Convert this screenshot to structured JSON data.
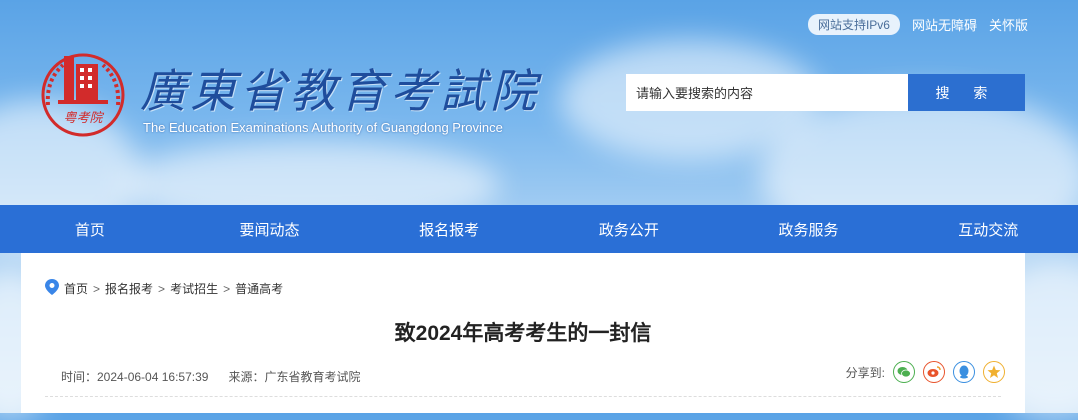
{
  "header": {
    "title_cn": "廣東省教育考試院",
    "title_en": "The Education Examinations Authority of Guangdong Province",
    "emblem_text": "粤考院",
    "ipv6_label": "网站支持IPv6",
    "accessibility_label": "网站无障碍",
    "care_label": "关怀版"
  },
  "search": {
    "placeholder": "请输入要搜索的内容",
    "button_label": "搜 索"
  },
  "nav": {
    "items": [
      {
        "label": "首页"
      },
      {
        "label": "要闻动态"
      },
      {
        "label": "报名报考"
      },
      {
        "label": "政务公开"
      },
      {
        "label": "政务服务"
      },
      {
        "label": "互动交流"
      }
    ]
  },
  "breadcrumb": [
    "首页",
    "报名报考",
    "考试招生",
    "普通高考"
  ],
  "article": {
    "title": "致2024年高考考生的一封信",
    "time": "时间：2024-06-04 16:57:39",
    "source": "来源：广东省教育考试院"
  },
  "share": {
    "label": "分享到:",
    "icons": [
      "wechat-icon",
      "weibo-icon",
      "qq-icon",
      "qzone-icon"
    ]
  },
  "colors": {
    "nav_bg": "#2a6fd6",
    "search_button": "#2c6fd0",
    "title_blue": "#1f4d9c",
    "emblem_red": "#d22b2b"
  }
}
